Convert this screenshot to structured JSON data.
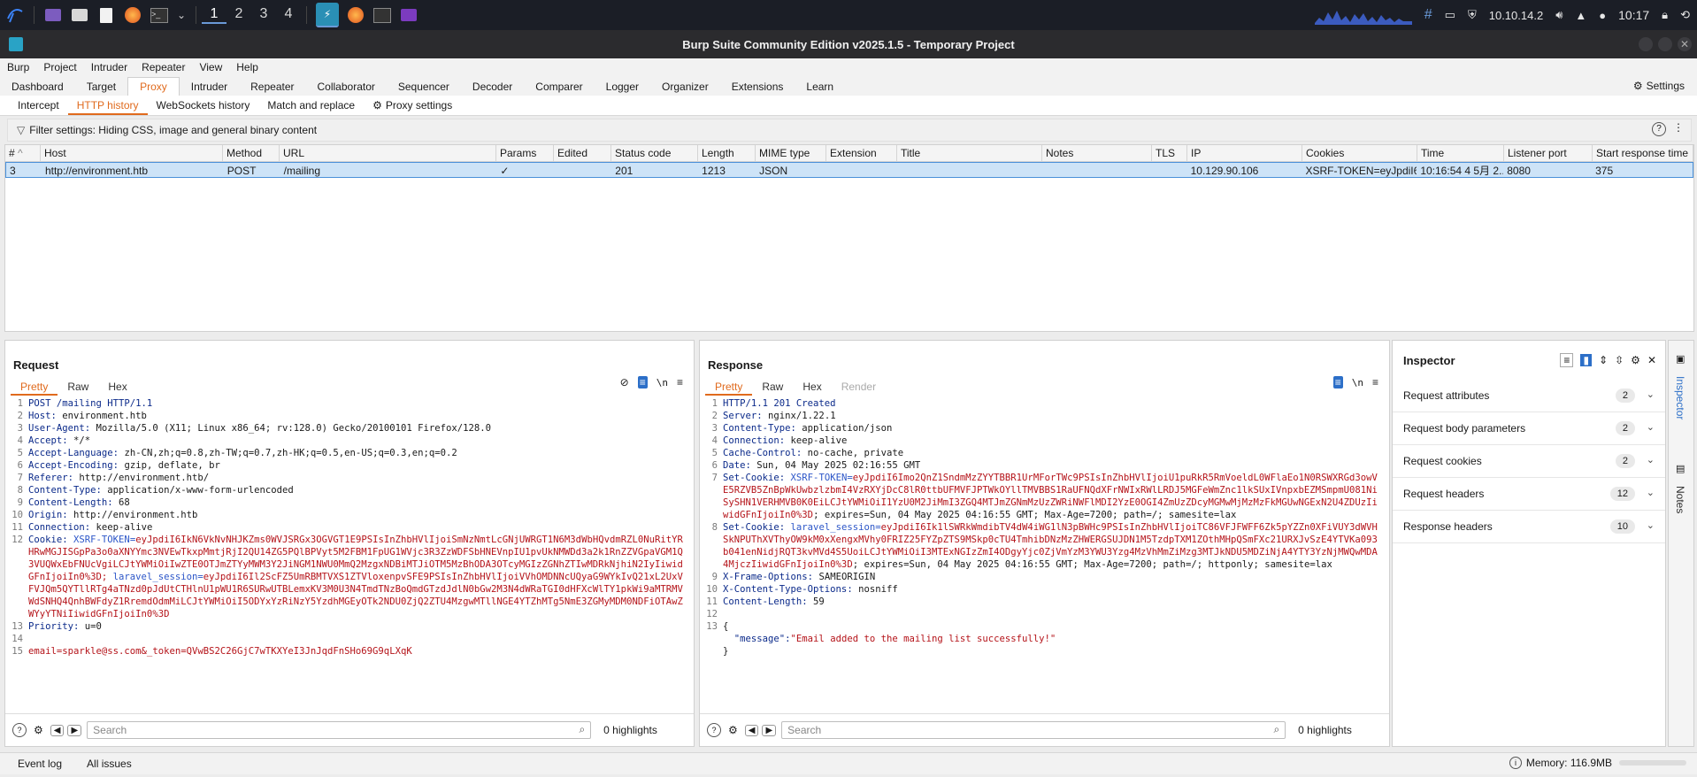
{
  "taskbar": {
    "workspaces": [
      "1",
      "2",
      "3",
      "4"
    ],
    "active_workspace": "1",
    "ip": "10.10.14.2",
    "clock": "10:17"
  },
  "window": {
    "title": "Burp Suite Community Edition v2025.1.5 - Temporary Project"
  },
  "menu": [
    "Burp",
    "Project",
    "Intruder",
    "Repeater",
    "View",
    "Help"
  ],
  "main_tabs": [
    "Dashboard",
    "Target",
    "Proxy",
    "Intruder",
    "Repeater",
    "Collaborator",
    "Sequencer",
    "Decoder",
    "Comparer",
    "Logger",
    "Organizer",
    "Extensions",
    "Learn"
  ],
  "settings_label": "Settings",
  "sub_tabs": [
    "Intercept",
    "HTTP history",
    "WebSockets history",
    "Match and replace"
  ],
  "proxy_settings_label": "Proxy settings",
  "filter_text": "Filter settings: Hiding CSS, image and general binary content",
  "table": {
    "columns": [
      "#",
      "Host",
      "Method",
      "URL",
      "Params",
      "Edited",
      "Status code",
      "Length",
      "MIME type",
      "Extension",
      "Title",
      "Notes",
      "TLS",
      "IP",
      "Cookies",
      "Time",
      "Listener port",
      "Start response time"
    ],
    "rows": [
      [
        "3",
        "http://environment.htb",
        "POST",
        "/mailing",
        "✓",
        "",
        "201",
        "1213",
        "JSON",
        "",
        "",
        "",
        "",
        "10.129.90.106",
        "XSRF-TOKEN=eyJpdiI6I...",
        "10:16:54 4 5月 2...",
        "8080",
        "375"
      ]
    ]
  },
  "request": {
    "title": "Request",
    "tabs": [
      "Pretty",
      "Raw",
      "Hex"
    ],
    "lines": [
      {
        "n": "1",
        "h": "POST /mailing HTTP/1.1",
        "v": ""
      },
      {
        "n": "2",
        "h": "Host:",
        "v": " environment.htb"
      },
      {
        "n": "3",
        "h": "User-Agent:",
        "v": " Mozilla/5.0 (X11; Linux x86_64; rv:128.0) Gecko/20100101 Firefox/128.0"
      },
      {
        "n": "4",
        "h": "Accept:",
        "v": " */*"
      },
      {
        "n": "5",
        "h": "Accept-Language:",
        "v": " zh-CN,zh;q=0.8,zh-TW;q=0.7,zh-HK;q=0.5,en-US;q=0.3,en;q=0.2"
      },
      {
        "n": "6",
        "h": "Accept-Encoding:",
        "v": " gzip, deflate, br"
      },
      {
        "n": "7",
        "h": "Referer:",
        "v": " http://environment.htb/"
      },
      {
        "n": "8",
        "h": "Content-Type:",
        "v": " application/x-www-form-urlencoded"
      },
      {
        "n": "9",
        "h": "Content-Length:",
        "v": " 68"
      },
      {
        "n": "10",
        "h": "Origin:",
        "v": " http://environment.htb"
      },
      {
        "n": "11",
        "h": "Connection:",
        "v": " keep-alive"
      },
      {
        "n": "12",
        "h": "Cookie:",
        "v": "",
        "ck": " XSRF-TOKEN=",
        "cv": "eyJpdiI6IkN6VkNvNHJKZms0WVJSRGx3OGVGT1E9PSIsInZhbHVlIjoiSmNzNmtLcGNjUWRGT1N6M3dWbHQvdmRZL0NuRitYRHRwMGJISGpPa3o0aXNYYmc3NVEwTkxpMmtjRjI2QU14ZG5PQlBPVyt5M2FBM1FpUG1WVjc3R3ZzWDFSbHNEVnpIU1pvUkNMWDd3a2k1RnZZVGpaVGM1Q3VUQWxEbFNUcVgiLCJtYWMiOiIwZTE0OTJmZTYyMWM3Y2JiNGM1NWU0MmQ2MzgxNDBiMTJiOTM5MzBhODA3OTcyMGIzZGNhZTIwMDRkNjhiN2IyIiwidGFnIjoiIn0%3D; ",
        "ck2": "laravel_session=",
        "cv2": "eyJpdiI6Il2ScFZ5UmRBMTVXS1ZTVloxenpvSFE9PSIsInZhbHVlIjoiVVhOMDNNcUQyaG9WYkIvQ21xL2UxVFVJQm5QYTllRTg4aTNzd0pJdUtCTHlnU1pWU1R6SURwUTBLemxKV3M0U3N4TmdTNzBoQmdGTzdJdlN0bGw2M3N4dWRaTGI0dHFXcWlTY1pkWi9aMTRMVWdSNHQ4QnhBWFdyZ1RremdOdmMiLCJtYWMiOiI5ODYxYzRiNzY5YzdhMGEyOTk2NDU0ZjQ2ZTU4MzgwMTllNGE4YTZhMTg5NmE3ZGMyMDM0NDFiOTAwZWYyYTNiIiwidGFnIjoiIn0%3D"
      },
      {
        "n": "13",
        "h": "Priority:",
        "v": " u=0"
      },
      {
        "n": "14",
        "h": "",
        "v": ""
      },
      {
        "n": "15",
        "h": "",
        "v": "",
        "body": "email=sparkle@ss.com&_token=QVwBS2C26GjC7wTKXYeI3JnJqdFnSHo69G9qLXqK"
      }
    ],
    "search_placeholder": "Search",
    "highlights": "0 highlights"
  },
  "response": {
    "title": "Response",
    "tabs": [
      "Pretty",
      "Raw",
      "Hex",
      "Render"
    ],
    "lines": [
      {
        "n": "1",
        "h": "HTTP/1.1 201 Created",
        "v": ""
      },
      {
        "n": "2",
        "h": "Server:",
        "v": " nginx/1.22.1"
      },
      {
        "n": "3",
        "h": "Content-Type:",
        "v": " application/json"
      },
      {
        "n": "4",
        "h": "Connection:",
        "v": " keep-alive"
      },
      {
        "n": "5",
        "h": "Cache-Control:",
        "v": " no-cache, private"
      },
      {
        "n": "6",
        "h": "Date:",
        "v": " Sun, 04 May 2025 02:16:55 GMT"
      },
      {
        "n": "7",
        "h": "Set-Cookie:",
        "v": "",
        "ck": " XSRF-TOKEN=",
        "cv": "eyJpdiI6Imo2QnZ1SndmMzZYYTBBR1UrMForTWc9PSIsInZhbHVlIjoiU1puRkR5RmVoeldL0WFlaEo1N0RSWXRGd3owVE5RZVB5ZnBpWkUwbzlzbmI4VzRXYjDcC8lR0ttbUFMVFJPTWkOYllTMVBBS1RaUFNQdXFrNWIxRWlLRDJ5MGFeWmZnc1lkSUxIVnpxbEZMSmpmU081NiSySHN1VERHMVB0K0EiLCJtYWMiOiI1YzU0M2JiMmI3ZGQ4MTJmZGNmMzUzZWRiNWFlMDI2YzE0OGI4ZmUzZDcyMGMwMjMzMzFkMGUwNGExN2U4ZDUzIiwidGFnIjoiIn0%3D",
        "tail": "; expires=Sun, 04 May 2025 04:16:55 GMT; Max-Age=7200; path=/; samesite=lax"
      },
      {
        "n": "8",
        "h": "Set-Cookie:",
        "v": "",
        "ck": " laravel_session=",
        "cv": "eyJpdiI6Ik1lSWRkWmdibTV4dW4iWG1lN3pBWHc9PSIsInZhbHVlIjoiTC86VFJFWFF6Zk5pYZZn0XFiVUY3dWVHSkNPUThXVThyOW9kM0xXengxMVhy0FRIZ25FYZpZTS9MSkp0cTU4TmhibDNzMzZHWERGSUJDN1M5TzdpTXM1ZOthMHpQSmFXc21URXJvSzE4YTVKa093b041enNidjRQT3kvMVd4S5UoiLCJtYWMiOiI3MTExNGIzZmI4ODgyYjc0ZjVmYzM3YWU3Yzg4MzVhMmZiMzg3MTJkNDU5MDZiNjA4YTY3YzNjMWQwMDA4MjczIiwidGFnIjoiIn0%3D",
        "tail": "; expires=Sun, 04 May 2025 04:16:55 GMT; Max-Age=7200; path=/; httponly; samesite=lax"
      },
      {
        "n": "9",
        "h": "X-Frame-Options:",
        "v": " SAMEORIGIN"
      },
      {
        "n": "10",
        "h": "X-Content-Type-Options:",
        "v": " nosniff"
      },
      {
        "n": "11",
        "h": "Content-Length:",
        "v": " 59"
      },
      {
        "n": "12",
        "h": "",
        "v": ""
      },
      {
        "n": "13",
        "h": "",
        "v": "{"
      },
      {
        "n": "",
        "h": "",
        "v": "",
        "jk": "  \"message\":",
        "jv": "\"Email added to the mailing list successfully!\""
      },
      {
        "n": "",
        "h": "",
        "v": "}"
      }
    ],
    "search_placeholder": "Search",
    "highlights": "0 highlights"
  },
  "inspector": {
    "title": "Inspector",
    "rows": [
      {
        "label": "Request attributes",
        "count": "2"
      },
      {
        "label": "Request body parameters",
        "count": "2"
      },
      {
        "label": "Request cookies",
        "count": "2"
      },
      {
        "label": "Request headers",
        "count": "12"
      },
      {
        "label": "Response headers",
        "count": "10"
      }
    ],
    "side_tabs": [
      "Inspector",
      "Notes"
    ]
  },
  "status": {
    "event_log": "Event log",
    "all_issues": "All issues",
    "memory": "Memory: 116.9MB"
  }
}
